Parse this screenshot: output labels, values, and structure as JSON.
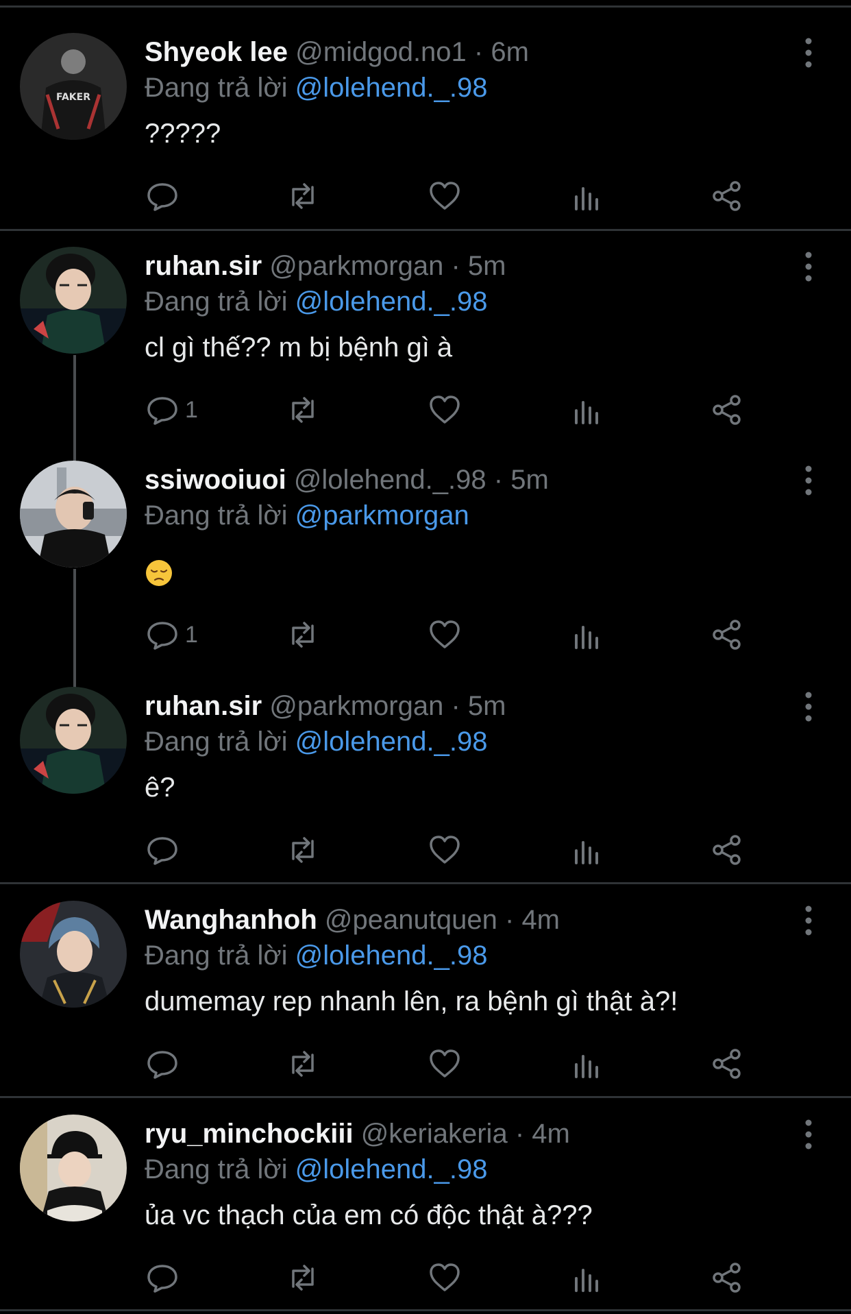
{
  "feed": {
    "replying_prefix": "Đang trả lời",
    "tweets": [
      {
        "name": "Shyeok lee",
        "handle": "@midgod.no1",
        "separator": "·",
        "time": "6m",
        "reply_to": "@lolehend._.98",
        "text": "?????",
        "reply_count": "",
        "avatar_label": "FAKER"
      },
      {
        "name": "ruhan.sir",
        "handle": "@parkmorgan",
        "separator": "·",
        "time": "5m",
        "reply_to": "@lolehend._.98",
        "text": "cl gì thế?? m bị bệnh gì à",
        "reply_count": "1",
        "avatar_label": ""
      },
      {
        "name": "ssiwooiuoi",
        "handle": "@lolehend._.98",
        "separator": "·",
        "time": "5m",
        "reply_to": "@parkmorgan",
        "text": "",
        "emoji": "pensive-face",
        "reply_count": "1",
        "avatar_label": ""
      },
      {
        "name": "ruhan.sir",
        "handle": "@parkmorgan",
        "separator": "·",
        "time": "5m",
        "reply_to": "@lolehend._.98",
        "text": "ê?",
        "reply_count": "",
        "avatar_label": ""
      },
      {
        "name": "Wanghanhoh",
        "handle": "@peanutquen",
        "separator": "·",
        "time": "4m",
        "reply_to": "@lolehend._.98",
        "text": "dumemay rep nhanh lên, ra bệnh gì thật à?!",
        "reply_count": "",
        "avatar_label": ""
      },
      {
        "name": "ryu_minchockiii",
        "handle": "@keriakeria",
        "separator": "·",
        "time": "4m",
        "reply_to": "@lolehend._.98",
        "text": "ủa vc thạch của em có độc thật à???",
        "reply_count": "",
        "avatar_label": ""
      }
    ]
  },
  "icons": [
    "reply-icon",
    "repost-icon",
    "like-icon",
    "views-icon",
    "share-icon",
    "more-icon"
  ],
  "colors": {
    "background": "#000000",
    "mention": "#4a99e9",
    "muted": "#71767b",
    "divider": "#2f3336"
  }
}
